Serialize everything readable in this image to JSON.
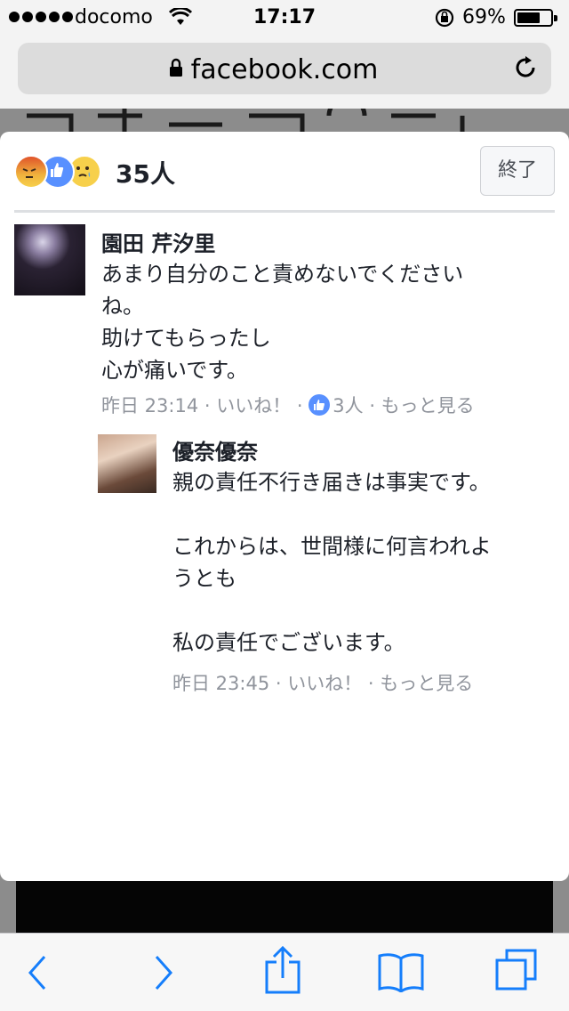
{
  "status_bar": {
    "carrier": "docomo",
    "time": "17:17",
    "battery": "69%",
    "battery_level": 0.69
  },
  "browser": {
    "url": "facebook.com"
  },
  "modal": {
    "reaction_icons": [
      "angry-icon",
      "like-icon",
      "sad-icon"
    ],
    "reaction_count": "35人",
    "close_label": "終了"
  },
  "comments": [
    {
      "name": "園田 芹汐里",
      "body": "あまり自分のこと責めないでください\nね。\n助けてもらったし\n心が痛いです。",
      "time": "昨日 23:14",
      "sep": " · ",
      "like_label": "いいね！",
      "like_count": "3人",
      "more_label": "もっと見る"
    },
    {
      "name": "優奈優奈",
      "body": "親の責任不行き届きは事実です。\n\nこれからは、世間様に何言われよ\nうとも\n\n私の責任でございます。",
      "time": "昨日 23:45",
      "sep": " · ",
      "like_label": "いいね！",
      "more_label": "もっと見る"
    }
  ],
  "toolbar": {
    "items": [
      "back-icon",
      "forward-icon",
      "share-icon",
      "bookmarks-icon",
      "tabs-icon"
    ]
  },
  "colors": {
    "like_blue": "#5890ff",
    "meta_gray": "#90949c",
    "text": "#1d2129"
  }
}
